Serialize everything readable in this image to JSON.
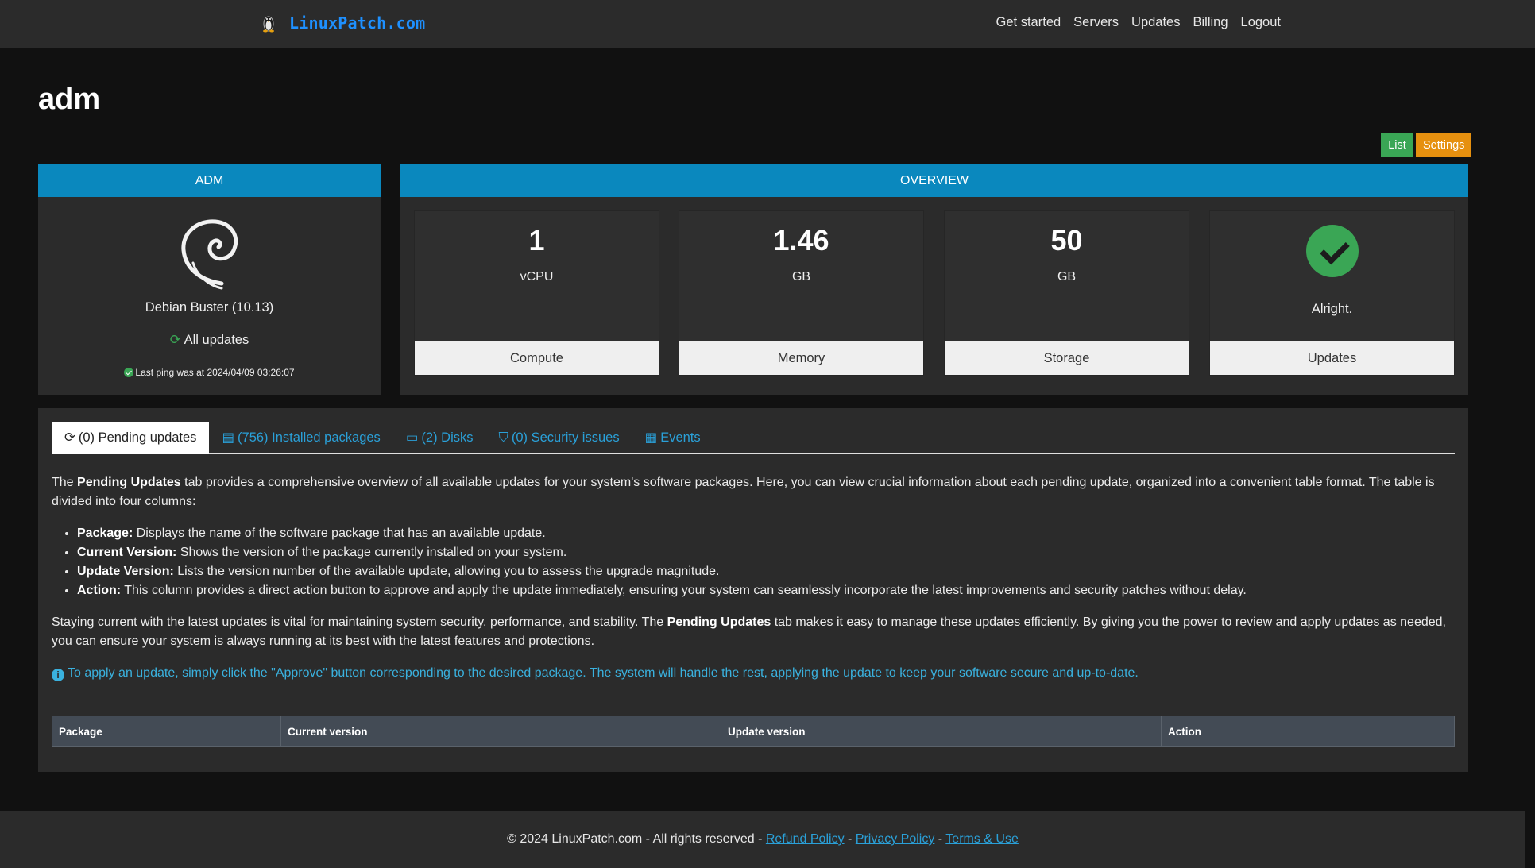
{
  "navbar": {
    "brand": "LinuxPatch.com",
    "links": [
      "Get started",
      "Servers",
      "Updates",
      "Billing",
      "Logout"
    ]
  },
  "page": {
    "title": "adm",
    "list_button": "List",
    "settings_button": "Settings"
  },
  "server_card": {
    "header": "ADM",
    "os_name": "Debian Buster (10.13)",
    "update_mode": "All updates",
    "last_ping": "Last ping was at 2024/04/09 03:26:07"
  },
  "overview": {
    "header": "OVERVIEW",
    "compute": {
      "value": "1",
      "unit": "vCPU",
      "label": "Compute"
    },
    "memory": {
      "value": "1.46",
      "unit": "GB",
      "label": "Memory"
    },
    "storage": {
      "value": "50",
      "unit": "GB",
      "label": "Storage"
    },
    "updates": {
      "status": "Alright.",
      "label": "Updates"
    }
  },
  "tabs": [
    {
      "label": "(0) Pending updates",
      "icon": "sync-icon"
    },
    {
      "label": "(756) Installed packages",
      "icon": "archive-icon"
    },
    {
      "label": "(2) Disks",
      "icon": "hdd-icon"
    },
    {
      "label": "(0) Security issues",
      "icon": "shield-icon"
    },
    {
      "label": "Events",
      "icon": "calendar-icon"
    }
  ],
  "content": {
    "intro_a": "The ",
    "intro_b": "Pending Updates",
    "intro_c": " tab provides a comprehensive overview of all available updates for your system's software packages. Here, you can view crucial information about each pending update, organized into a convenient table format. The table is divided into four columns:",
    "items": [
      {
        "term": "Package:",
        "desc": " Displays the name of the software package that has an available update."
      },
      {
        "term": "Current Version:",
        "desc": " Shows the version of the package currently installed on your system."
      },
      {
        "term": "Update Version:",
        "desc": " Lists the version number of the available update, allowing you to assess the upgrade magnitude."
      },
      {
        "term": "Action:",
        "desc": " This column provides a direct action button to approve and apply the update immediately, ensuring your system can seamlessly incorporate the latest improvements and security patches without delay."
      }
    ],
    "outro_a": "Staying current with the latest updates is vital for maintaining system security, performance, and stability. The ",
    "outro_b": "Pending Updates",
    "outro_c": " tab makes it easy to manage these updates efficiently. By giving you the power to review and apply updates as needed, you can ensure your system is always running at its best with the latest features and protections.",
    "info": "To apply an update, simply click the \"Approve\" button corresponding to the desired package. The system will handle the rest, applying the update to keep your software secure and up-to-date."
  },
  "table": {
    "headers": [
      "Package",
      "Current version",
      "Update version",
      "Action"
    ]
  },
  "footer": {
    "copyright": "© 2024 LinuxPatch.com - All rights reserved - ",
    "sep": " - ",
    "refund": "Refund Policy",
    "privacy": "Privacy Policy",
    "terms": "Terms & Use"
  },
  "colors": {
    "brand": "#1e90ff",
    "card_header": "#0a88be",
    "success": "#3aa655",
    "warning": "#e6900f",
    "link": "#2aa0d8"
  }
}
